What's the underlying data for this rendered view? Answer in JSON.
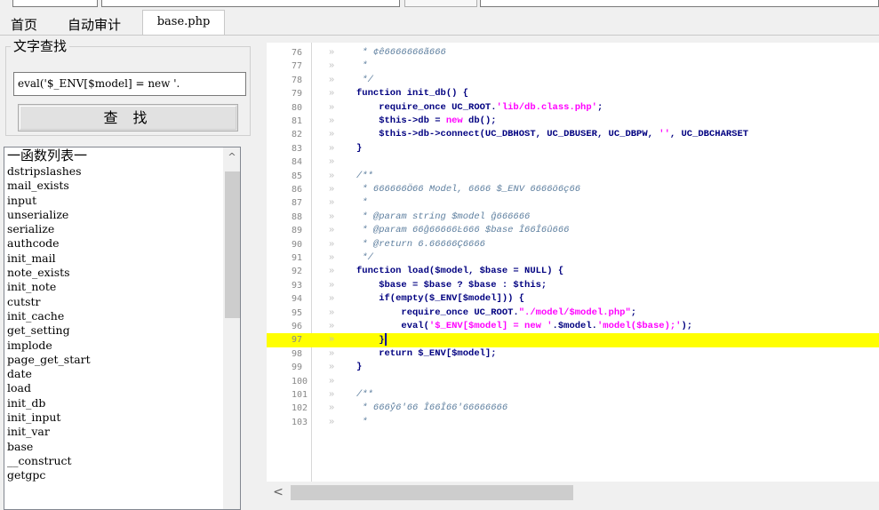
{
  "tabs": [
    {
      "label": "首页"
    },
    {
      "label": "自动审计"
    },
    {
      "label": "base.php"
    }
  ],
  "search": {
    "group_title": "文字查找",
    "input_value": "eval('$_ENV[$model] = new '.",
    "button_label": "查 找"
  },
  "function_list": {
    "header": "一函数列表一",
    "items": [
      "dstripslashes",
      "mail_exists",
      "input",
      "unserialize",
      "serialize",
      "authcode",
      "init_mail",
      "note_exists",
      "init_note",
      "cutstr",
      "init_cache",
      "get_setting",
      "implode",
      "page_get_start",
      "date",
      "load",
      "init_db",
      "init_input",
      "init_var",
      "base",
      "__construct",
      "getgpc"
    ]
  },
  "editor": {
    "lines": [
      {
        "n": "76",
        "segs": [
          {
            "t": " * ¢ê6666666ã666",
            "c": "c-comment"
          }
        ]
      },
      {
        "n": "77",
        "segs": [
          {
            "t": " *",
            "c": "c-comment"
          }
        ]
      },
      {
        "n": "78",
        "segs": [
          {
            "t": " */",
            "c": "c-comment"
          }
        ]
      },
      {
        "n": "79",
        "segs": [
          {
            "t": "function init_db() {",
            "c": "c-kw"
          }
        ]
      },
      {
        "n": "80",
        "segs": [
          {
            "t": "\trequire_once UC_ROOT.",
            "c": "c-norm"
          },
          {
            "t": "'lib/db.class.php'",
            "c": "c-str"
          },
          {
            "t": ";",
            "c": "c-norm"
          }
        ]
      },
      {
        "n": "81",
        "segs": [
          {
            "t": "\t$this->db = ",
            "c": "c-norm"
          },
          {
            "t": "new",
            "c": "c-str"
          },
          {
            "t": " db();",
            "c": "c-norm"
          }
        ]
      },
      {
        "n": "82",
        "segs": [
          {
            "t": "\t$this->db->connect(UC_DBHOST, UC_DBUSER, UC_DBPW, ",
            "c": "c-norm"
          },
          {
            "t": "''",
            "c": "c-str"
          },
          {
            "t": ", UC_DBCHARSET",
            "c": "c-norm"
          }
        ]
      },
      {
        "n": "83",
        "segs": [
          {
            "t": "}",
            "c": "c-norm"
          }
        ]
      },
      {
        "n": "84",
        "segs": []
      },
      {
        "n": "85",
        "segs": [
          {
            "t": "/**",
            "c": "c-comment"
          }
        ]
      },
      {
        "n": "86",
        "segs": [
          {
            "t": " * 666666Ö66 Model, 6666 $_ENV 6666ö6ç66",
            "c": "c-comment"
          }
        ]
      },
      {
        "n": "87",
        "segs": [
          {
            "t": " *",
            "c": "c-comment"
          }
        ]
      },
      {
        "n": "88",
        "segs": [
          {
            "t": " * @param string $model ĝ666666",
            "c": "c-comment"
          }
        ]
      },
      {
        "n": "89",
        "segs": [
          {
            "t": " * @param 66ĝ66666Ŀ666 $base Î66Î6û666",
            "c": "c-comment"
          }
        ]
      },
      {
        "n": "90",
        "segs": [
          {
            "t": " * @return 6.66666Ç6666",
            "c": "c-comment"
          }
        ]
      },
      {
        "n": "91",
        "segs": [
          {
            "t": " */",
            "c": "c-comment"
          }
        ]
      },
      {
        "n": "92",
        "segs": [
          {
            "t": "function load($model, $base = NULL) {",
            "c": "c-kw"
          }
        ]
      },
      {
        "n": "93",
        "segs": [
          {
            "t": "\t$base = $base ? $base : $this;",
            "c": "c-norm"
          }
        ]
      },
      {
        "n": "94",
        "segs": [
          {
            "t": "\tif(empty($_ENV[$model])) {",
            "c": "c-norm"
          }
        ]
      },
      {
        "n": "95",
        "segs": [
          {
            "t": "\t\trequire_once UC_ROOT.",
            "c": "c-norm"
          },
          {
            "t": "\"./model/$model.php\"",
            "c": "c-str"
          },
          {
            "t": ";",
            "c": "c-norm"
          }
        ]
      },
      {
        "n": "96",
        "segs": [
          {
            "t": "\t\teval(",
            "c": "c-norm"
          },
          {
            "t": "'$_ENV[$model] = new '",
            "c": "c-str"
          },
          {
            "t": ".$model.",
            "c": "c-norm"
          },
          {
            "t": "'model($base);'",
            "c": "c-str"
          },
          {
            "t": ");",
            "c": "c-norm"
          }
        ]
      },
      {
        "n": "97",
        "segs": [
          {
            "t": "\t}",
            "c": "c-norm"
          }
        ],
        "highlight": true,
        "caret": true
      },
      {
        "n": "98",
        "segs": [
          {
            "t": "\treturn $_ENV[$model];",
            "c": "c-norm"
          }
        ]
      },
      {
        "n": "99",
        "segs": [
          {
            "t": "}",
            "c": "c-norm"
          }
        ]
      },
      {
        "n": "100",
        "segs": []
      },
      {
        "n": "101",
        "segs": [
          {
            "t": "/**",
            "c": "c-comment"
          }
        ]
      },
      {
        "n": "102",
        "segs": [
          {
            "t": " * 666ẙ6'66 Î66Î66'66666666",
            "c": "c-comment"
          }
        ]
      },
      {
        "n": "103",
        "segs": [
          {
            "t": " *",
            "c": "c-comment"
          }
        ]
      }
    ]
  },
  "scroll": {
    "up_arrow": "^",
    "left_arrow": "<"
  }
}
